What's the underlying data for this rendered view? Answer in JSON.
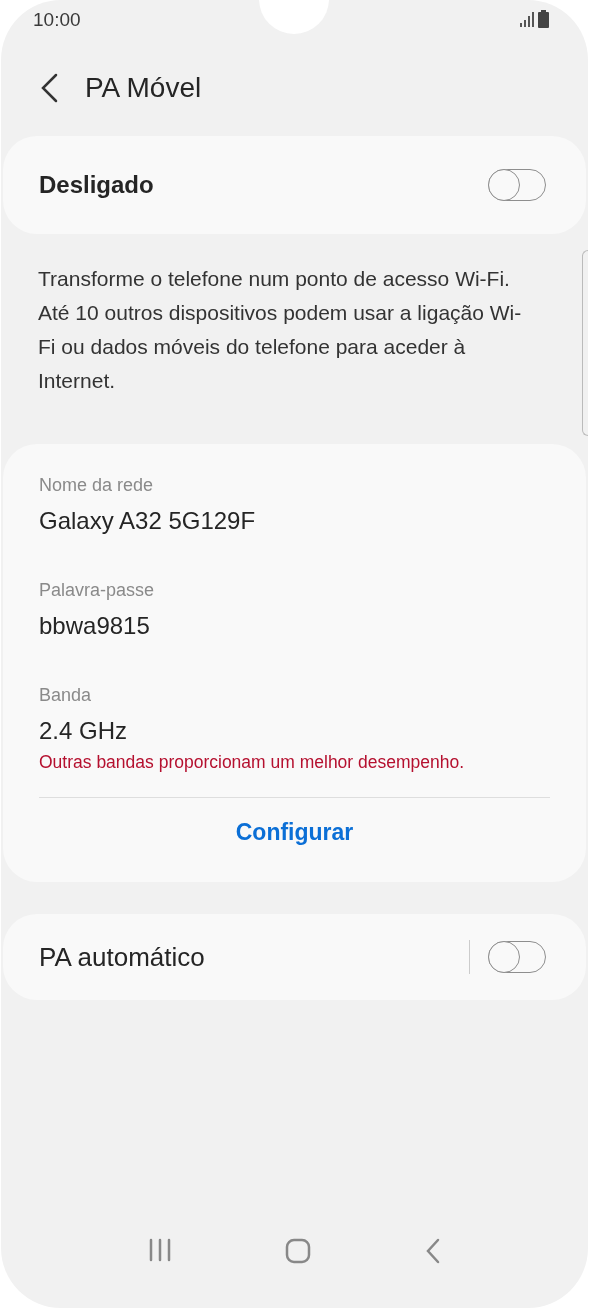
{
  "status_bar": {
    "time": "10:00"
  },
  "header": {
    "title": "PA Móvel"
  },
  "master_switch": {
    "label": "Desligado",
    "on": false
  },
  "description": "Transforme o telefone num ponto de acesso Wi-Fi. Até 10 outros dispositivos podem usar a ligação Wi-Fi ou dados móveis do telefone para aceder à Internet.",
  "network": {
    "fields": [
      {
        "label": "Nome da rede",
        "value": "Galaxy A32 5G129F"
      },
      {
        "label": "Palavra-passe",
        "value": "bbwa9815"
      },
      {
        "label": "Banda",
        "value": "2.4 GHz",
        "note": "Outras bandas proporcionam um melhor desempenho."
      }
    ],
    "action": "Configurar"
  },
  "auto_hotspot": {
    "label": "PA automático",
    "on": false
  }
}
